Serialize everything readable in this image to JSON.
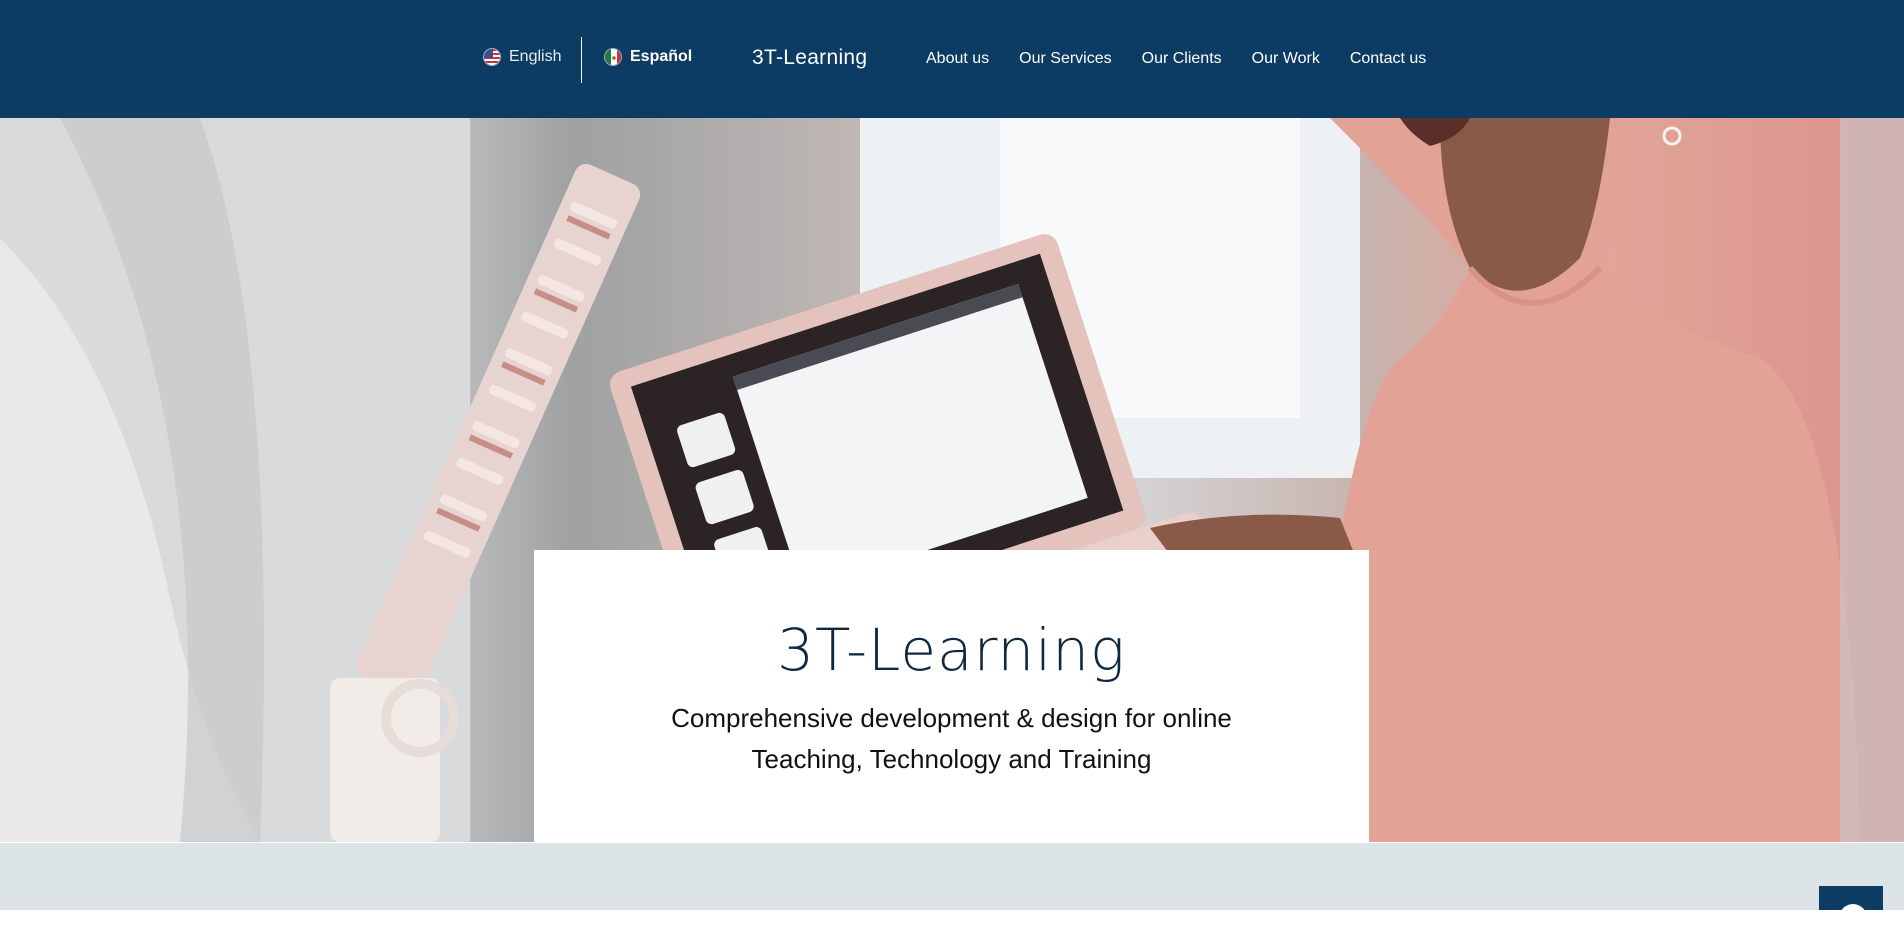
{
  "header": {
    "languages": [
      {
        "label": "English",
        "flag": "us-flag-icon"
      },
      {
        "label": "Español",
        "flag": "mexico-flag-icon"
      }
    ],
    "brand": "3T-Learning",
    "nav": [
      "About us",
      "Our Services",
      "Our Clients",
      "Our Work",
      "Contact us"
    ]
  },
  "hero": {
    "title": "3T-Learning",
    "subtitle_line1": "Comprehensive development & design for online",
    "subtitle_line2": "Teaching, Technology and Training"
  },
  "colors": {
    "header_bg": "#0c3b63",
    "card_bg": "#ffffff",
    "title_color": "#0d2840",
    "strip_bg": "#dde4e8"
  },
  "widgets": {
    "chat_icon": "chat-icon"
  }
}
